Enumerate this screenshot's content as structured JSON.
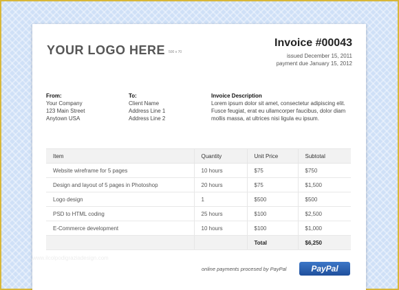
{
  "header": {
    "logo": "YOUR LOGO HERE",
    "logo_size": "500 x 70",
    "title": "Invoice #00043",
    "issued": "issued December 15, 2011",
    "due": "payment due January 15, 2012"
  },
  "from": {
    "heading": "From:",
    "lines": [
      "Your Company",
      "123 Main Street",
      "Anytown USA"
    ]
  },
  "to": {
    "heading": "To:",
    "lines": [
      "Client Name",
      "Address Line 1",
      "Address Line 2"
    ]
  },
  "description": {
    "heading": "Invoice Description",
    "text": "Lorem ipsum dolor sit amet, consectetur adipiscing elit. Fusce feugiat, erat eu ullamcorper faucibus, dolor diam mollis massa, at ultrices nisi ligula eu ipsum."
  },
  "table": {
    "headers": [
      "Item",
      "Quantity",
      "Unit Price",
      "Subtotal"
    ],
    "rows": [
      [
        "Website wireframe for 5 pages",
        "10 hours",
        "$75",
        "$750"
      ],
      [
        "Design and layout of 5 pages in Photoshop",
        "20 hours",
        "$75",
        "$1,500"
      ],
      [
        "Logo design",
        "1",
        "$500",
        "$500"
      ],
      [
        "PSD to HTML coding",
        "25 hours",
        "$100",
        "$2,500"
      ],
      [
        "E-Commerce development",
        "10 hours",
        "$100",
        "$1,000"
      ]
    ],
    "total_label": "Total",
    "total_value": "$6,250"
  },
  "footer": {
    "watermark": "www.ilcolpodigraziadesign.com",
    "payment_note": "online payments procesed by PayPal",
    "paypal_label": "PayPal"
  },
  "colors": {
    "frame": "#d8b73a",
    "background": "#cfe0f7",
    "paypal_button": "#2a5fae"
  }
}
